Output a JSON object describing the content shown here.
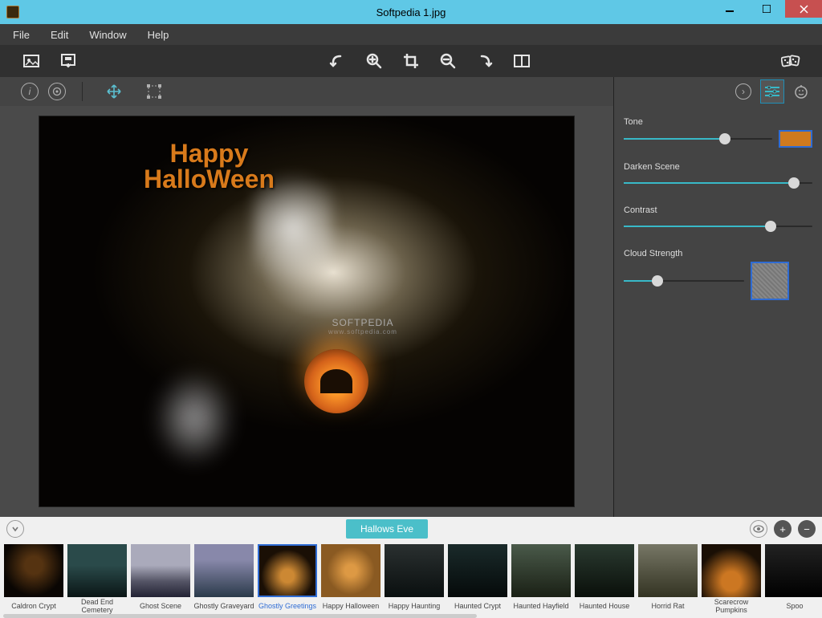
{
  "window": {
    "title": "Softpedia 1.jpg"
  },
  "menu": {
    "file": "File",
    "edit": "Edit",
    "window": "Window",
    "help": "Help"
  },
  "canvas": {
    "headline_l1": "Happy",
    "headline_l2": "HalloWeen",
    "watermark": "SOFTPEDIA",
    "watermark_url": "www.softpedia.com"
  },
  "panel": {
    "tone": {
      "label": "Tone",
      "value": 68,
      "color": "#cf7a1e"
    },
    "darken": {
      "label": "Darken Scene",
      "value": 90
    },
    "contrast": {
      "label": "Contrast",
      "value": 78
    },
    "cloud": {
      "label": "Cloud Strength",
      "value": 28
    }
  },
  "presetBar": {
    "current": "Hallows Eve"
  },
  "thumbs": [
    {
      "label": "Caldron Crypt"
    },
    {
      "label": "Dead End Cemetery"
    },
    {
      "label": "Ghost Scene"
    },
    {
      "label": "Ghostly Graveyard"
    },
    {
      "label": "Ghostly Greetings",
      "selected": true
    },
    {
      "label": "Happy Halloween"
    },
    {
      "label": "Happy Haunting"
    },
    {
      "label": "Haunted Crypt"
    },
    {
      "label": "Haunted Hayfield"
    },
    {
      "label": "Haunted House"
    },
    {
      "label": "Horrid Rat"
    },
    {
      "label": "Scarecrow Pumpkins"
    },
    {
      "label": "Spoo"
    }
  ]
}
